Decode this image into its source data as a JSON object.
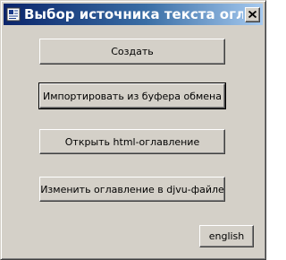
{
  "window": {
    "title": "Выбор источника текста оглавле..."
  },
  "buttons": {
    "create": "Создать",
    "import_clipboard": "Импортировать из буфера обмена",
    "open_html": "Открыть html-оглавление",
    "edit_djvu": "Изменить оглавление в djvu-файле",
    "language": "english"
  },
  "colors": {
    "dialog_face": "#d4d0c8",
    "titlebar_start": "#0a246a",
    "titlebar_end": "#a6caf0",
    "title_text": "#ffffff"
  },
  "icons": {
    "app": "app-icon",
    "close": "close-icon"
  }
}
